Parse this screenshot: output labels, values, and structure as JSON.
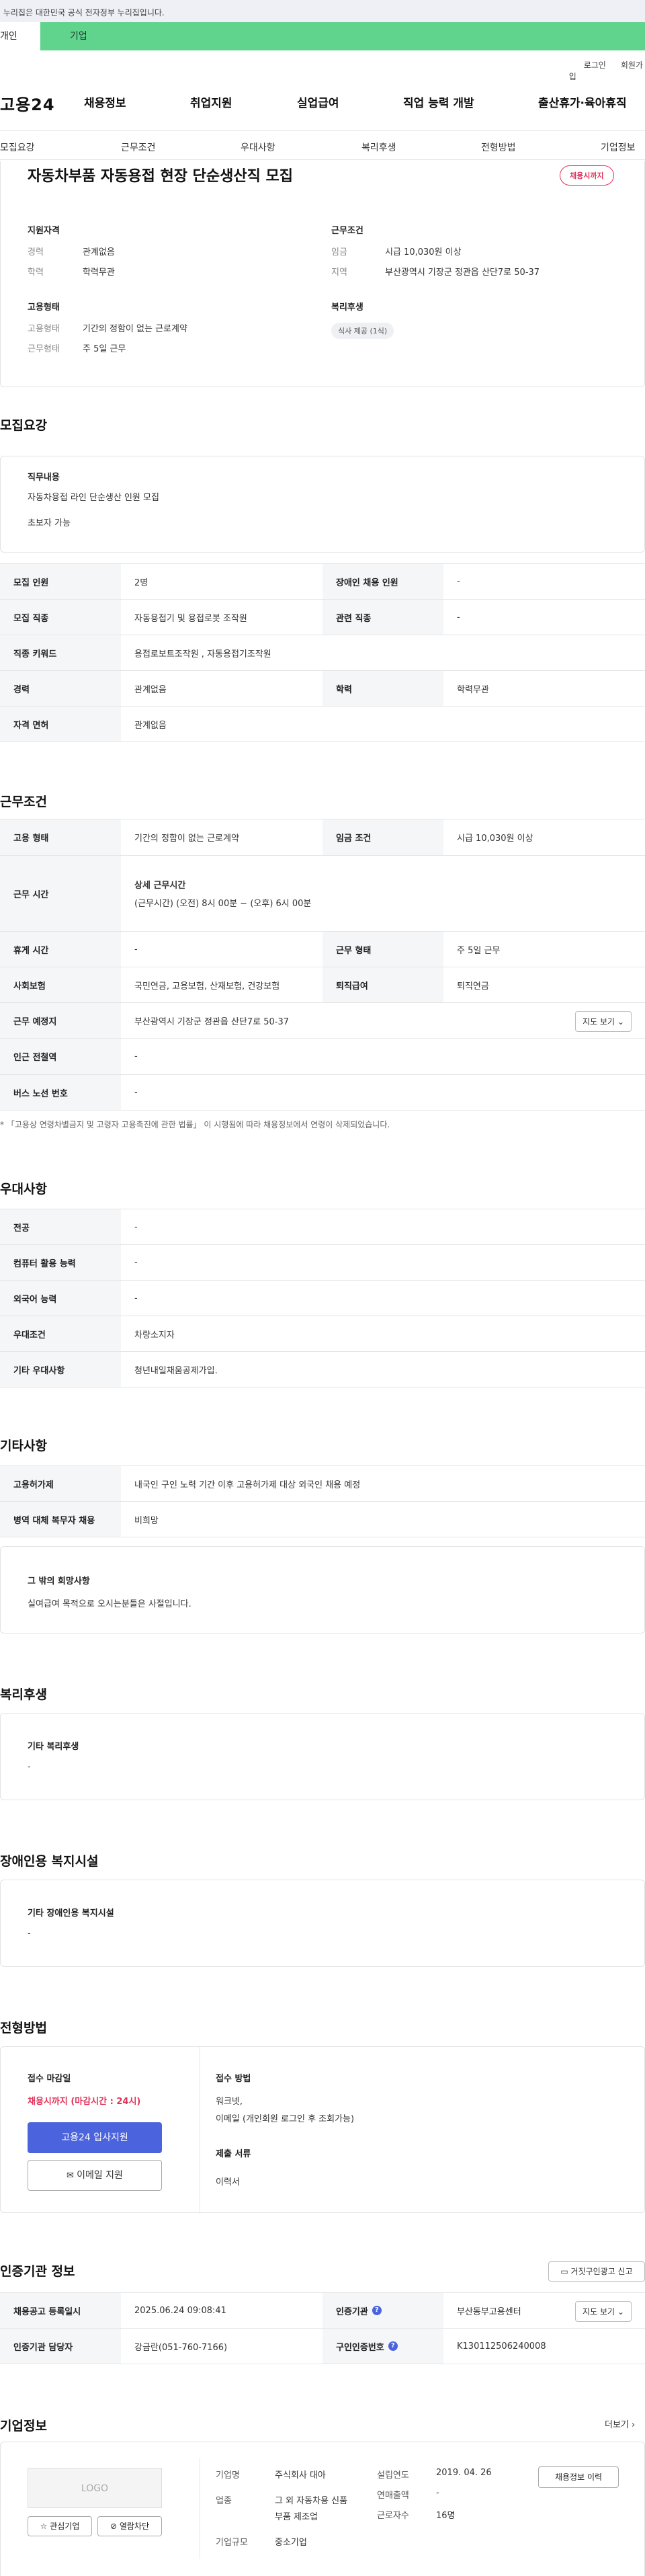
{
  "gov_banner": "이 누리집은 대한민국 공식 전자정부 누리집입니다.",
  "user_tabs": {
    "individual": "개인",
    "corporate": "기업"
  },
  "top_links": [
    "로그인",
    "회원가입"
  ],
  "logo": "고용24",
  "gnb": [
    "채용정보",
    "취업지원",
    "실업급여",
    "직업 능력 개발",
    "출산휴가·육아휴직"
  ],
  "subnav": [
    "모집요강",
    "근무조건",
    "우대사항",
    "복리후생",
    "전형방법",
    "기업정보"
  ],
  "summary": {
    "title": "자동차부품 자동용접 현장 단순생산직 모집",
    "status_badge": "채용시까지",
    "qualification_heading": "지원자격",
    "qualification": [
      {
        "label": "경력",
        "value": "관계없음"
      },
      {
        "label": "학력",
        "value": "학력무관"
      }
    ],
    "employment_heading": "고용형태",
    "employment": [
      {
        "label": "고용형태",
        "value": "기간의 정함이 없는 근로계약"
      },
      {
        "label": "근무형태",
        "value": "주 5일 근무"
      }
    ],
    "conditions_heading": "근무조건",
    "conditions": [
      {
        "label": "임금",
        "value": "시급 10,030원 이상"
      },
      {
        "label": "지역",
        "value": "부산광역시 기장군 정관읍 산단7로 50-37"
      }
    ],
    "welfare_heading": "복리후생",
    "welfare_badge": "식사 제공 (1식)"
  },
  "recruit": {
    "heading": "모집요강",
    "job_title": "직무내용",
    "job_lines": [
      "자동차용접 라인 단순생산 인원 모집",
      "초보자 가능"
    ],
    "rows": [
      {
        "a": "모집 인원",
        "av": "2명",
        "b": "장애인 채용 인원",
        "bv": "-"
      },
      {
        "a": "모집 직종",
        "av": "자동용접기 및 용접로봇 조작원",
        "b": "관련 직종",
        "bv": "-"
      },
      {
        "a": "직종 키워드",
        "av": "용접로보트조작원 , 자동용접기조작원"
      },
      {
        "a": "경력",
        "av": "관계없음",
        "b": "학력",
        "bv": "학력무관"
      },
      {
        "a": "자격 면허",
        "av": "관계없음"
      }
    ]
  },
  "work": {
    "heading": "근무조건",
    "employment_type_label": "고용 형태",
    "employment_type": "기간의 정함이 없는 근로계약",
    "wage_label": "임금 조건",
    "wage": "시급 10,030원 이상",
    "hours_label": "근무 시간",
    "hours_title": "상세 근무시간",
    "hours_detail": "(근무시간) (오전) 8시 00분 ~ (오후) 6시 00분",
    "break_label": "휴게 시간",
    "break": "-",
    "form_label": "근무 형태",
    "form": "주 5일 근무",
    "insurance_label": "사회보험",
    "insurance": "국민연금, 고용보험, 산재보험, 건강보험",
    "severance_label": "퇴직급여",
    "severance": "퇴직연금",
    "place_label": "근무 예정지",
    "place": "부산광역시 기장군 정관읍 산단7로 50-37",
    "map_button": "지도 보기",
    "subway_label": "인근 전철역",
    "subway": "-",
    "bus_label": "버스 노선 번호",
    "bus": "-",
    "note": "* 「고용상 연령차별금지 및 고령자 고용촉진에 관한 법률」 이 시행됨에 따라 채용정보에서 연령이 삭제되었습니다."
  },
  "pref": {
    "heading": "우대사항",
    "rows": [
      {
        "k": "전공",
        "v": "-"
      },
      {
        "k": "컴퓨터 활용 능력",
        "v": "-"
      },
      {
        "k": "외국어 능력",
        "v": "-"
      },
      {
        "k": "우대조건",
        "v": "차량소지자"
      },
      {
        "k": "기타 우대사항",
        "v": "청년내일채움공제가입."
      }
    ]
  },
  "etc": {
    "heading": "기타사항",
    "rows": [
      {
        "k": "고용허가제",
        "v": "내국인 구인 노력 기간 이후 고용허가제 대상 외국인 채용 예정"
      },
      {
        "k": "병역 대체 복무자 채용",
        "v": "비희망"
      }
    ],
    "other_title": "그 밖의 희망사항",
    "other_text": "실여급여 목적으로 오시는분들은 사절입니다."
  },
  "benefit": {
    "heading": "복리후생",
    "title": "기타 복리후생",
    "value": "-"
  },
  "disabled": {
    "heading": "장애인용 복지시설",
    "title": "기타 장애인용 복지시설",
    "value": "-"
  },
  "process": {
    "heading": "전형방법",
    "deadline_title": "접수 마감일",
    "deadline": "채용시까지 (마감시간 : 24시)",
    "apply_button": "고용24 입사지원",
    "email_button": "이메일 지원",
    "method_title": "접수 방법",
    "method_lines": [
      "워크넷,",
      "이메일 (개인회원 로그인 후 조회가능)"
    ],
    "docs_title": "제출 서류",
    "docs": "이력서"
  },
  "agency": {
    "heading": "인증기관 정보",
    "report_button": "거짓구인광고 신고",
    "rows": [
      {
        "a": "채용공고 등록일시",
        "av": "2025.06.24 09:08:41",
        "b": "인증기관",
        "bv": "부산동부고용센터",
        "btn": "지도 보기"
      },
      {
        "a": "인증기관 담당자",
        "av": "강금란(051-760-7166)",
        "b": "구인인증번호",
        "bv": "K130112506240008"
      }
    ]
  },
  "company": {
    "heading": "기업정보",
    "more": "더보기",
    "logo_text": "LOGO",
    "fav_button": "관심기업",
    "block_button": "열람차단",
    "fields": [
      {
        "k": "기업명",
        "v": "주식회사 대아"
      },
      {
        "k": "업종",
        "v": "그 외 자동차용 신품 부품 제조업"
      },
      {
        "k": "기업규모",
        "v": "중소기업"
      },
      {
        "k": "설립연도",
        "v": "2019. 04. 26"
      },
      {
        "k": "연매출액",
        "v": "-"
      },
      {
        "k": "근로자수",
        "v": "16명"
      }
    ],
    "history_button": "채용정보 이력"
  }
}
